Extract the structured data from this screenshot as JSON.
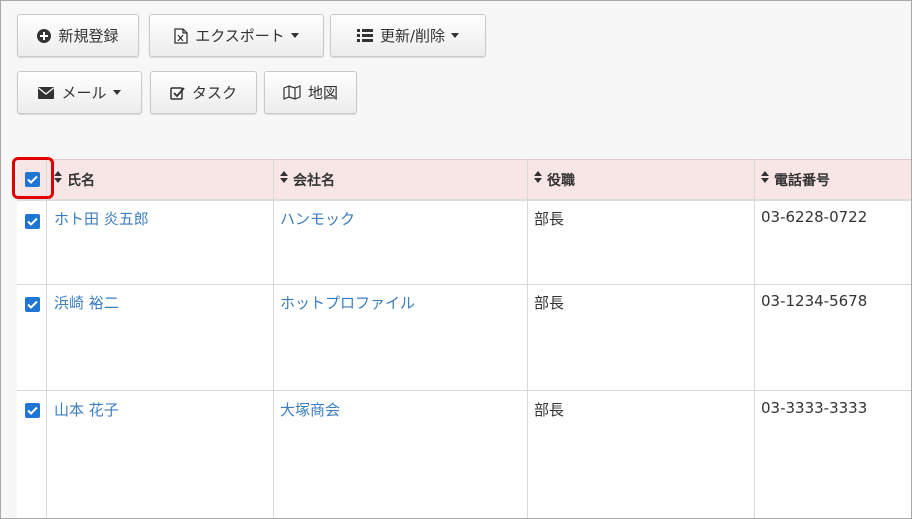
{
  "toolbar": {
    "new_label": "新規登録",
    "export_label": "エクスポート",
    "update_label": "更新/削除",
    "mail_label": "メール",
    "task_label": "タスク",
    "map_label": "地図"
  },
  "table": {
    "columns": [
      "氏名",
      "会社名",
      "役職",
      "電話番号"
    ],
    "rows": [
      {
        "name": "ホト田 炎五郎",
        "company": "ハンモック",
        "title": "部長",
        "phone": "03-6228-0722",
        "checked": true
      },
      {
        "name": "浜崎 裕二",
        "company": "ホットプロファイル",
        "title": "部長",
        "phone": "03-1234-5678",
        "checked": true
      },
      {
        "name": "山本 花子",
        "company": "大塚商会",
        "title": "部長",
        "phone": "03-3333-3333",
        "checked": true
      }
    ],
    "select_all_checked": true
  },
  "colors": {
    "link": "#3b7ec0",
    "header_bg": "#f8e6e6",
    "checkbox": "#1f75d4",
    "highlight": "#e00000"
  }
}
